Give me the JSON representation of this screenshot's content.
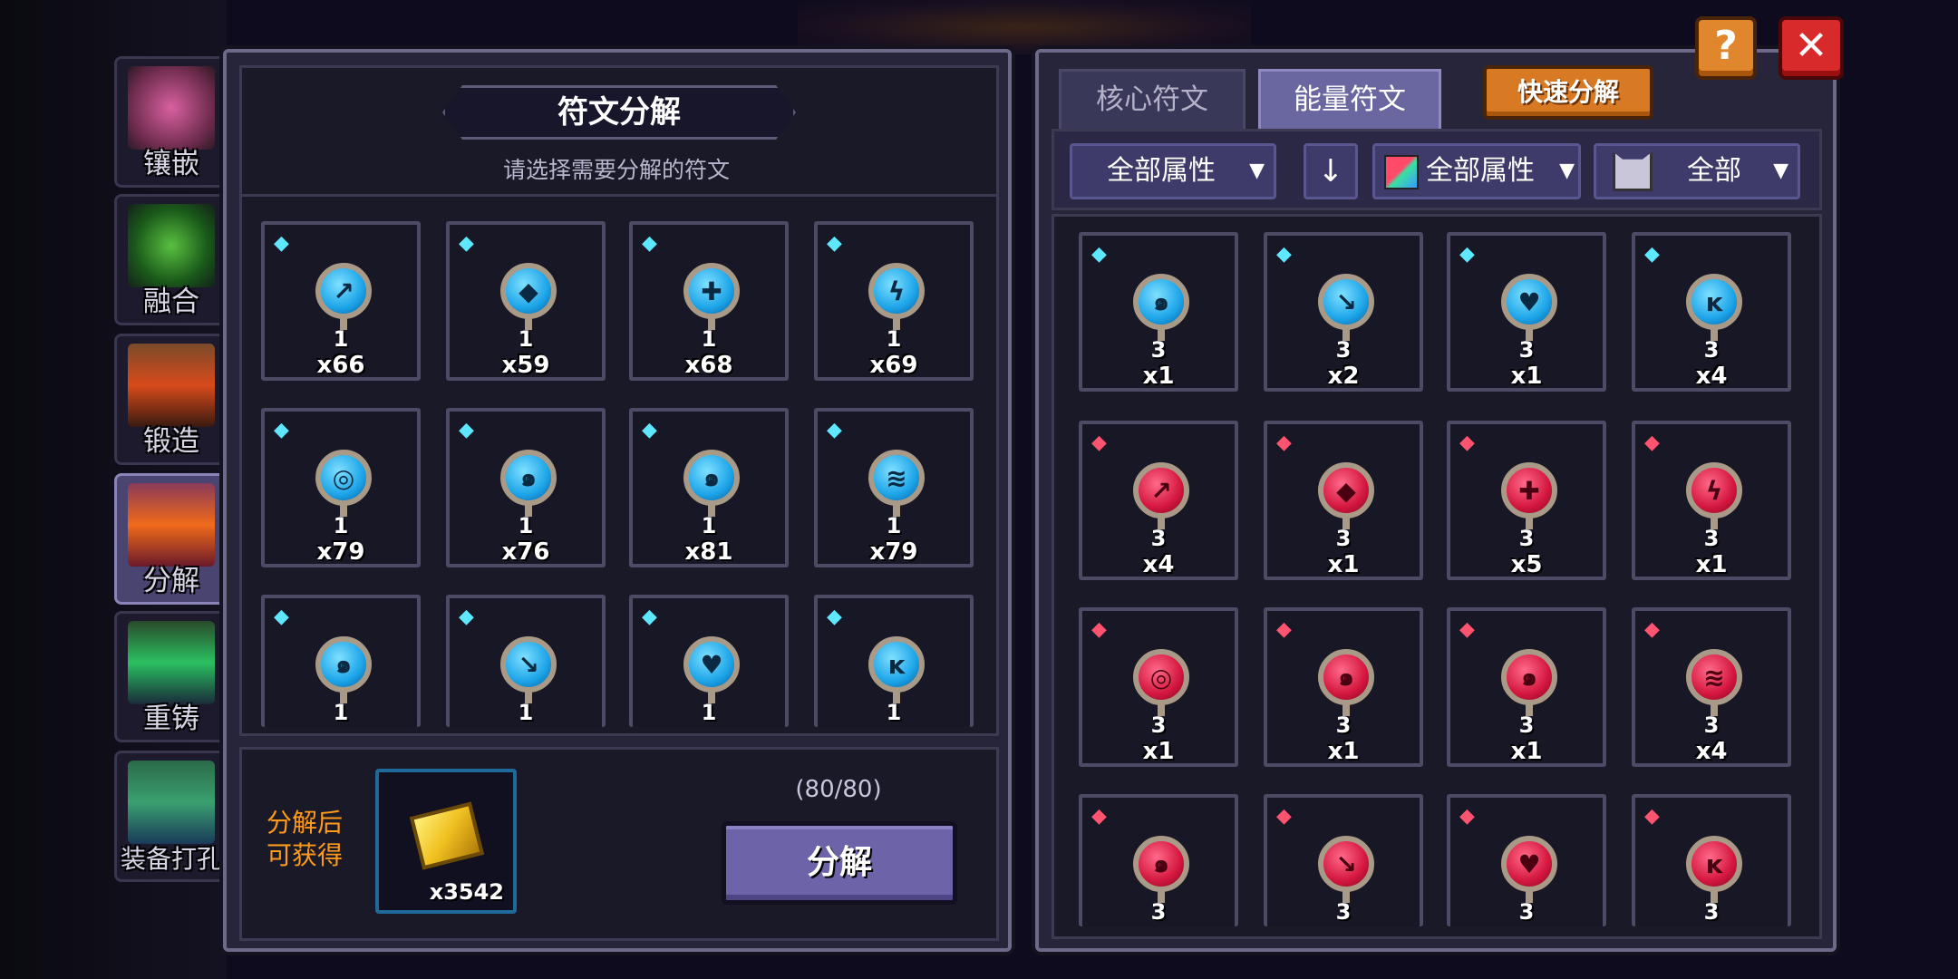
{
  "side_menu": [
    {
      "label": "镶嵌",
      "icon": "inlay-icon",
      "active": false
    },
    {
      "label": "融合",
      "icon": "fusion-icon",
      "active": false
    },
    {
      "label": "锻造",
      "icon": "forge-icon",
      "active": false
    },
    {
      "label": "分解",
      "icon": "decompose-icon",
      "active": true
    },
    {
      "label": "重铸",
      "icon": "recast-icon",
      "active": false
    },
    {
      "label": "装备打孔",
      "icon": "equipment-punch-icon",
      "active": false
    }
  ],
  "left_panel": {
    "title": "符文分解",
    "subtitle": "请选择需要分解的符文",
    "slots": [
      {
        "level": "1",
        "count": "x66",
        "symbol": "↗"
      },
      {
        "level": "1",
        "count": "x59",
        "symbol": "◆"
      },
      {
        "level": "1",
        "count": "x68",
        "symbol": "✚"
      },
      {
        "level": "1",
        "count": "x69",
        "symbol": "ϟ"
      },
      {
        "level": "1",
        "count": "x79",
        "symbol": "◎"
      },
      {
        "level": "1",
        "count": "x76",
        "symbol": "๑"
      },
      {
        "level": "1",
        "count": "x81",
        "symbol": "๑"
      },
      {
        "level": "1",
        "count": "x79",
        "symbol": "≋"
      },
      {
        "level": "1",
        "count": "",
        "symbol": "๑"
      },
      {
        "level": "1",
        "count": "",
        "symbol": "↘"
      },
      {
        "level": "1",
        "count": "",
        "symbol": "♥"
      },
      {
        "level": "1",
        "count": "",
        "symbol": "ĸ"
      }
    ],
    "reward_label": "分解后\n可获得",
    "reward_count": "x3542",
    "capacity": "(80/80)",
    "decompose_button": "分解"
  },
  "right_panel": {
    "tabs": [
      {
        "label": "核心符文",
        "active": false
      },
      {
        "label": "能量符文",
        "active": true
      }
    ],
    "quick_button": "快速分解",
    "help_button": "?",
    "close_button": "✕",
    "filters": {
      "attribute": "全部属性",
      "sort_icon": "↓",
      "element": "全部属性",
      "type": "全部"
    },
    "slots": [
      {
        "color": "blue",
        "level": "3",
        "count": "x1",
        "symbol": "๑"
      },
      {
        "color": "blue",
        "level": "3",
        "count": "x2",
        "symbol": "↘"
      },
      {
        "color": "blue",
        "level": "3",
        "count": "x1",
        "symbol": "♥"
      },
      {
        "color": "blue",
        "level": "3",
        "count": "x4",
        "symbol": "ĸ"
      },
      {
        "color": "red",
        "level": "3",
        "count": "x4",
        "symbol": "↗"
      },
      {
        "color": "red",
        "level": "3",
        "count": "x1",
        "symbol": "◆"
      },
      {
        "color": "red",
        "level": "3",
        "count": "x5",
        "symbol": "✚"
      },
      {
        "color": "red",
        "level": "3",
        "count": "x1",
        "symbol": "ϟ"
      },
      {
        "color": "red",
        "level": "3",
        "count": "x1",
        "symbol": "◎"
      },
      {
        "color": "red",
        "level": "3",
        "count": "x1",
        "symbol": "๑"
      },
      {
        "color": "red",
        "level": "3",
        "count": "x1",
        "symbol": "๑"
      },
      {
        "color": "red",
        "level": "3",
        "count": "x4",
        "symbol": "≋"
      },
      {
        "color": "red",
        "level": "3",
        "count": "",
        "symbol": "๑"
      },
      {
        "color": "red",
        "level": "3",
        "count": "",
        "symbol": "↘"
      },
      {
        "color": "red",
        "level": "3",
        "count": "",
        "symbol": "♥"
      },
      {
        "color": "red",
        "level": "3",
        "count": "",
        "symbol": "ĸ"
      }
    ]
  },
  "colors": {
    "accent_orange": "#d87a24",
    "close_red": "#d82a2a",
    "button_purple": "#6c63a8",
    "rune_blue": "#1ca4e8",
    "rune_red": "#d4163e",
    "reward_label": "#ff9a1a"
  }
}
